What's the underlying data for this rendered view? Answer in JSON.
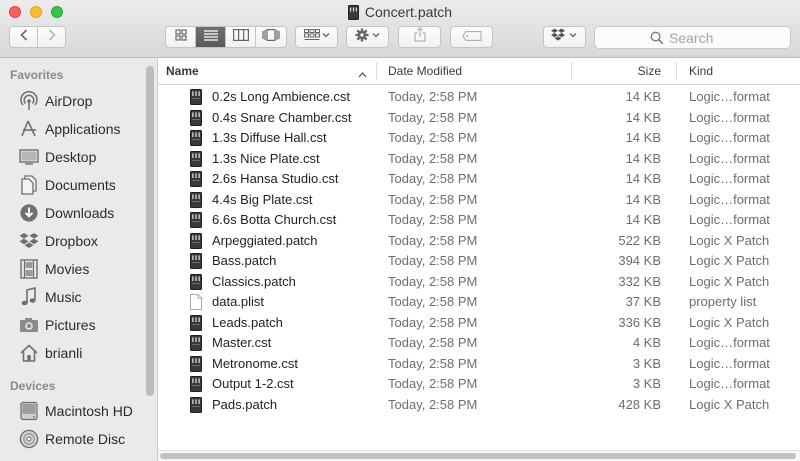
{
  "window": {
    "title": "Concert.patch"
  },
  "toolbar": {
    "back_icon": "chevron-left-icon",
    "forward_icon": "chevron-right-icon",
    "views": [
      "icon-view",
      "list-view",
      "column-view",
      "cover-flow-view"
    ],
    "active_view": "list-view",
    "arrange_icon": "arrange-grid-icon",
    "action_icon": "gear-icon",
    "share_icon": "share-icon",
    "tag_icon": "tag-icon",
    "dropbox_icon": "dropbox-icon"
  },
  "search": {
    "placeholder": "Search"
  },
  "sidebar": {
    "favorites_label": "Favorites",
    "favorites": [
      {
        "label": "AirDrop",
        "icon": "airdrop-icon"
      },
      {
        "label": "Applications",
        "icon": "applications-icon"
      },
      {
        "label": "Desktop",
        "icon": "desktop-icon"
      },
      {
        "label": "Documents",
        "icon": "documents-icon"
      },
      {
        "label": "Downloads",
        "icon": "downloads-icon"
      },
      {
        "label": "Dropbox",
        "icon": "dropbox-icon"
      },
      {
        "label": "Movies",
        "icon": "movies-icon"
      },
      {
        "label": "Music",
        "icon": "music-icon"
      },
      {
        "label": "Pictures",
        "icon": "pictures-icon"
      },
      {
        "label": "brianli",
        "icon": "home-icon"
      }
    ],
    "devices_label": "Devices",
    "devices": [
      {
        "label": "Macintosh HD",
        "icon": "hard-drive-icon"
      },
      {
        "label": "Remote Disc",
        "icon": "disc-icon"
      }
    ]
  },
  "table": {
    "columns": {
      "name": "Name",
      "date": "Date Modified",
      "size": "Size",
      "kind": "Kind"
    },
    "sort_column": "Name",
    "sort_direction": "ascending",
    "rows": [
      {
        "name": "0.2s Long Ambience.cst",
        "date": "Today, 2:58 PM",
        "size": "14 KB",
        "kind": "Logic…format",
        "icon": "patch-file-icon"
      },
      {
        "name": "0.4s Snare Chamber.cst",
        "date": "Today, 2:58 PM",
        "size": "14 KB",
        "kind": "Logic…format",
        "icon": "patch-file-icon"
      },
      {
        "name": "1.3s Diffuse Hall.cst",
        "date": "Today, 2:58 PM",
        "size": "14 KB",
        "kind": "Logic…format",
        "icon": "patch-file-icon"
      },
      {
        "name": "1.3s Nice Plate.cst",
        "date": "Today, 2:58 PM",
        "size": "14 KB",
        "kind": "Logic…format",
        "icon": "patch-file-icon"
      },
      {
        "name": "2.6s Hansa Studio.cst",
        "date": "Today, 2:58 PM",
        "size": "14 KB",
        "kind": "Logic…format",
        "icon": "patch-file-icon"
      },
      {
        "name": "4.4s Big Plate.cst",
        "date": "Today, 2:58 PM",
        "size": "14 KB",
        "kind": "Logic…format",
        "icon": "patch-file-icon"
      },
      {
        "name": "6.6s Botta Church.cst",
        "date": "Today, 2:58 PM",
        "size": "14 KB",
        "kind": "Logic…format",
        "icon": "patch-file-icon"
      },
      {
        "name": "Arpeggiated.patch",
        "date": "Today, 2:58 PM",
        "size": "522 KB",
        "kind": "Logic X Patch",
        "icon": "patch-file-icon"
      },
      {
        "name": "Bass.patch",
        "date": "Today, 2:58 PM",
        "size": "394 KB",
        "kind": "Logic X Patch",
        "icon": "patch-file-icon"
      },
      {
        "name": "Classics.patch",
        "date": "Today, 2:58 PM",
        "size": "332 KB",
        "kind": "Logic X Patch",
        "icon": "patch-file-icon"
      },
      {
        "name": "data.plist",
        "date": "Today, 2:58 PM",
        "size": "37 KB",
        "kind": "property list",
        "icon": "document-file-icon"
      },
      {
        "name": "Leads.patch",
        "date": "Today, 2:58 PM",
        "size": "336 KB",
        "kind": "Logic X Patch",
        "icon": "patch-file-icon"
      },
      {
        "name": "Master.cst",
        "date": "Today, 2:58 PM",
        "size": "4 KB",
        "kind": "Logic…format",
        "icon": "patch-file-icon"
      },
      {
        "name": "Metronome.cst",
        "date": "Today, 2:58 PM",
        "size": "3 KB",
        "kind": "Logic…format",
        "icon": "patch-file-icon"
      },
      {
        "name": "Output 1-2.cst",
        "date": "Today, 2:58 PM",
        "size": "3 KB",
        "kind": "Logic…format",
        "icon": "patch-file-icon"
      },
      {
        "name": "Pads.patch",
        "date": "Today, 2:58 PM",
        "size": "428 KB",
        "kind": "Logic X Patch",
        "icon": "patch-file-icon"
      }
    ]
  }
}
